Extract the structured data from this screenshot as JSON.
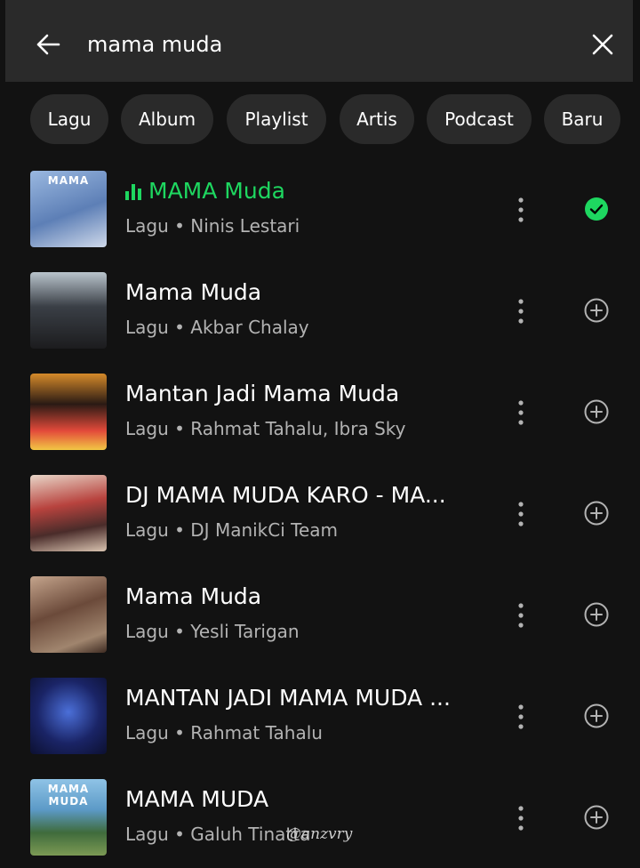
{
  "search": {
    "query": "mama muda",
    "back_icon": "arrow-left-icon",
    "clear_icon": "close-icon"
  },
  "filters": [
    "Lagu",
    "Album",
    "Playlist",
    "Artis",
    "Podcast",
    "Baru"
  ],
  "colors": {
    "accent": "#1ed760",
    "background": "#121212",
    "chip": "#2a2a2a",
    "secondary_text": "#b3b3b3"
  },
  "results": [
    {
      "title": "MAMA Muda",
      "subtitle": "Lagu • Ninis Lestari",
      "cover_text": "MAMA",
      "playing": true,
      "added": true
    },
    {
      "title": "Mama Muda",
      "subtitle": "Lagu • Akbar Chalay",
      "cover_text": "",
      "playing": false,
      "added": false
    },
    {
      "title": "Mantan Jadi Mama Muda",
      "subtitle": "Lagu • Rahmat Tahalu, Ibra Sky",
      "cover_text": "",
      "playing": false,
      "added": false
    },
    {
      "title": "DJ MAMA MUDA KARO - MA...",
      "subtitle": "Lagu • DJ ManikCi Team",
      "cover_text": "",
      "playing": false,
      "added": false
    },
    {
      "title": "Mama Muda",
      "subtitle": "Lagu • Yesli Tarigan",
      "cover_text": "",
      "playing": false,
      "added": false
    },
    {
      "title": "MANTAN JADI MAMA MUDA ...",
      "subtitle": "Lagu • Rahmat Tahalu",
      "cover_text": "",
      "playing": false,
      "added": false
    },
    {
      "title": "MAMA MUDA",
      "subtitle": "Lagu • Galuh Tinatta",
      "cover_text": "MAMA MUDA",
      "playing": false,
      "added": false
    }
  ],
  "watermark": "@anzvry"
}
